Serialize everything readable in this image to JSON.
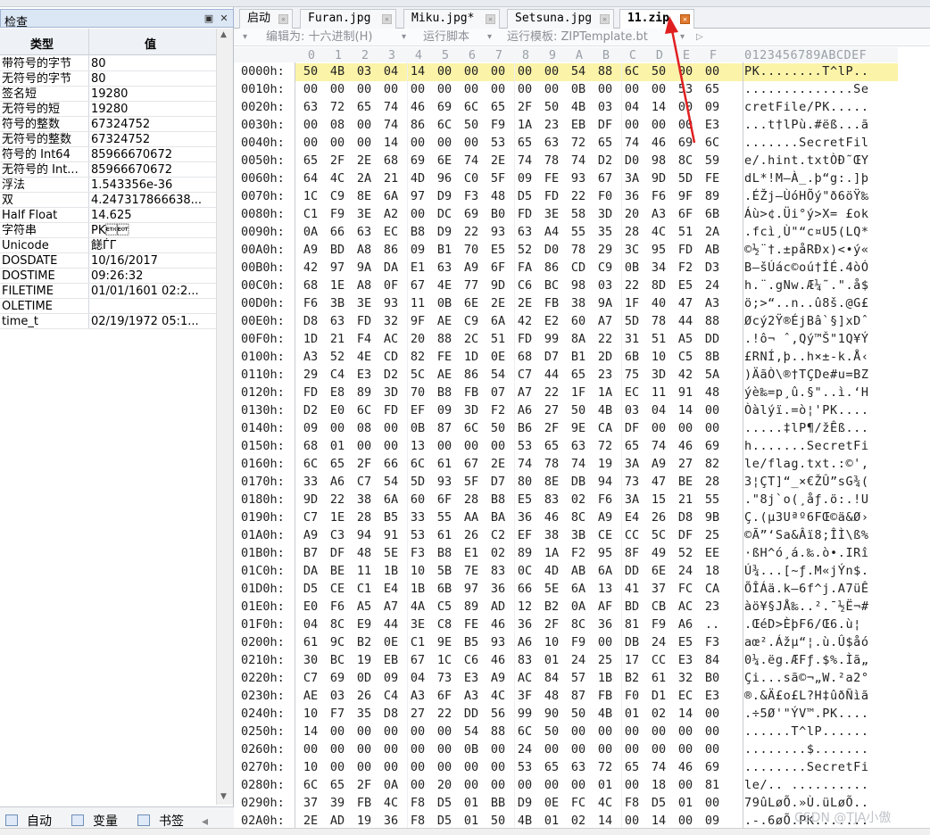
{
  "inspector": {
    "title": "检查",
    "col_type": "类型",
    "col_value": "值",
    "rows": [
      {
        "k": "带符号的字节",
        "v": "80"
      },
      {
        "k": "无符号的字节",
        "v": "80"
      },
      {
        "k": "签名短",
        "v": "19280"
      },
      {
        "k": "无符号的短",
        "v": "19280"
      },
      {
        "k": "符号的整数",
        "v": "67324752"
      },
      {
        "k": "无符号的整数",
        "v": "67324752"
      },
      {
        "k": "符号的 Int64",
        "v": "85966670672"
      },
      {
        "k": "无符号的 Int...",
        "v": "85966670672"
      },
      {
        "k": "浮法",
        "v": "1.543356e-36"
      },
      {
        "k": "双",
        "v": "4.247317866638..."
      },
      {
        "k": "Half Float",
        "v": "14.625"
      },
      {
        "k": "字符串",
        "v": "PK\u0003\u0004"
      },
      {
        "k": "Unicode",
        "v": "䭐ЃΓ"
      },
      {
        "k": "DOSDATE",
        "v": "10/16/2017"
      },
      {
        "k": "DOSTIME",
        "v": "09:26:32"
      },
      {
        "k": "FILETIME",
        "v": "01/01/1601 02:2..."
      },
      {
        "k": "OLETIME",
        "v": ""
      },
      {
        "k": "time_t",
        "v": "02/19/1972 05:1..."
      }
    ]
  },
  "bottom_tabs": [
    "自动",
    "变量",
    "书签"
  ],
  "tabs": [
    {
      "label": "启动"
    },
    {
      "label": "Furan.jpg"
    },
    {
      "label": "Miku.jpg*"
    },
    {
      "label": "Setsuna.jpg"
    },
    {
      "label": "11.zip"
    }
  ],
  "toolbar": {
    "edit_as": "编辑为: 十六进制(H)",
    "run_script": "运行脚本",
    "run_template": "运行模板: ZIPTemplate.bt"
  },
  "hex": {
    "columns": [
      "0",
      "1",
      "2",
      "3",
      "4",
      "5",
      "6",
      "7",
      "8",
      "9",
      "A",
      "B",
      "C",
      "D",
      "E",
      "F"
    ],
    "ascii_header": "0123456789ABCDEF",
    "rows": [
      {
        "o": "0000h:",
        "b": "50 4B 03 04 14 00 00 00 00 00 54 88 6C 50 00 00",
        "a": "PK........T^lP.."
      },
      {
        "o": "0010h:",
        "b": "00 00 00 00 00 00 00 00 00 00 0B 00 00 00 53 65",
        "a": "..............Se"
      },
      {
        "o": "0020h:",
        "b": "63 72 65 74 46 69 6C 65 2F 50 4B 03 04 14 00 09",
        "a": "cretFile/PK....."
      },
      {
        "o": "0030h:",
        "b": "00 08 00 74 86 6C 50 F9 1A 23 EB DF 00 00 00 E3",
        "a": "...t†lPù.#ëß...ã"
      },
      {
        "o": "0040h:",
        "b": "00 00 00 14 00 00 00 53 65 63 72 65 74 46 69 6C",
        "a": ".......SecretFil"
      },
      {
        "o": "0050h:",
        "b": "65 2F 2E 68 69 6E 74 2E 74 78 74 D2 D0 98 8C 59",
        "a": "e/.hint.txtÒÐ˜ŒY"
      },
      {
        "o": "0060h:",
        "b": "64 4C 2A 21 4D 96 C0 5F 09 FE 93 67 3A 9D 5D FE",
        "a": "dL*!M–À_.þ“g:.]þ"
      },
      {
        "o": "0070h:",
        "b": "1C C9 8E 6A 97 D9 F3 48 D5 FD 22 F0 36 F6 9F 89",
        "a": ".ÉŽj—ÙóHÕý\"ð6öŸ‰"
      },
      {
        "o": "0080h:",
        "b": "C1 F9 3E A2 00 DC 69 B0 FD 3E 58 3D 20 A3 6F 6B",
        "a": "Áù>¢.Üi°ý>X= £ok"
      },
      {
        "o": "0090h:",
        "b": "0A 66 63 EC B8 D9 22 93 63 A4 55 35 28 4C 51 2A",
        "a": ".fcì¸Ù\"“c¤U5(LQ*"
      },
      {
        "o": "00A0h:",
        "b": "A9 BD A8 86 09 B1 70 E5 52 D0 78 29 3C 95 FD AB",
        "a": "©½¨†.±påRÐx)<•ý«"
      },
      {
        "o": "00B0h:",
        "b": "42 97 9A DA E1 63 A9 6F FA 86 CD C9 0B 34 F2 D3",
        "a": "B—šÚác©oú†ÍÉ.4òÓ"
      },
      {
        "o": "00C0h:",
        "b": "68 1E A8 0F 67 4E 77 9D C6 BC 98 03 22 8D E5 24",
        "a": "h.¨.gNw.Æ¼˜.\".å$"
      },
      {
        "o": "00D0h:",
        "b": "F6 3B 3E 93 11 0B 6E 2E 2E FB 38 9A 1F 40 47 A3",
        "a": "ö;>“..n..û8š.@G£"
      },
      {
        "o": "00E0h:",
        "b": "D8 63 FD 32 9F AE C9 6A 42 E2 60 A7 5D 78 44 88",
        "a": "Øcý2Ÿ®ÉjBâ`§]xDˆ"
      },
      {
        "o": "00F0h:",
        "b": "1D 21 F4 AC 20 88 2C 51 FD 99 8A 22 31 51 A5 DD",
        "a": ".!ô¬ ˆ,Qý™Š\"1Q¥Ý"
      },
      {
        "o": "0100h:",
        "b": "A3 52 4E CD 82 FE 1D 0E 68 D7 B1 2D 6B 10 C5 8B",
        "a": "£RNÍ‚þ..h×±-k.Å‹"
      },
      {
        "o": "0110h:",
        "b": "29 C4 E3 D2 5C AE 86 54 C7 44 65 23 75 3D 42 5A",
        "a": ")ÄãÒ\\®†TÇDe#u=BZ"
      },
      {
        "o": "0120h:",
        "b": "FD E8 89 3D 70 B8 FB 07 A7 22 1F 1A EC 11 91 48",
        "a": "ýè‰=p¸û.§\"..ì.‘H"
      },
      {
        "o": "0130h:",
        "b": "D2 E0 6C FD EF 09 3D F2 A6 27 50 4B 03 04 14 00",
        "a": "Òàlýï.=ò¦'PK...."
      },
      {
        "o": "0140h:",
        "b": "09 00 08 00 0B 87 6C 50 B6 2F 9E CA DF 00 00 00",
        "a": ".....‡lP¶/žÊß..."
      },
      {
        "o": "0150h:",
        "b": "68 01 00 00 13 00 00 00 53 65 63 72 65 74 46 69",
        "a": "h.......SecretFi"
      },
      {
        "o": "0160h:",
        "b": "6C 65 2F 66 6C 61 67 2E 74 78 74 19 3A A9 27 82",
        "a": "le/flag.txt.:©'‚"
      },
      {
        "o": "0170h:",
        "b": "33 A6 C7 54 5D 93 5F D7 80 8E DB 94 73 47 BE 28",
        "a": "3¦ÇT]“_×€ŽÛ”sG¾("
      },
      {
        "o": "0180h:",
        "b": "9D 22 38 6A 60 6F 28 B8 E5 83 02 F6 3A 15 21 55",
        "a": ".\"8j`o(¸åƒ.ö:.!U"
      },
      {
        "o": "0190h:",
        "b": "C7 1E 28 B5 33 55 AA BA 36 46 8C A9 E4 26 D8 9B",
        "a": "Ç.(µ3Uªº6FŒ©ä&Ø›"
      },
      {
        "o": "01A0h:",
        "b": "A9 C3 94 91 53 61 26 C2 EF 38 3B CE CC 5C DF 25",
        "a": "©Ã”‘Sa&Âï8;ÎÌ\\ß%"
      },
      {
        "o": "01B0h:",
        "b": "B7 DF 48 5E F3 B8 E1 02 89 1A F2 95 8F 49 52 EE",
        "a": "·ßH^ó¸á.‰.ò•.IRî"
      },
      {
        "o": "01C0h:",
        "b": "DA BE 11 1B 10 5B 7E 83 0C 4D AB 6A DD 6E 24 18",
        "a": "Ú¾...[~ƒ.M«jÝn$."
      },
      {
        "o": "01D0h:",
        "b": "D5 CE C1 E4 1B 6B 97 36 66 5E 6A 13 41 37 FC CA",
        "a": "ÕÎÁä.k—6f^j.A7üÊ"
      },
      {
        "o": "01E0h:",
        "b": "E0 F6 A5 A7 4A C5 89 AD 12 B2 0A AF BD CB AC 23",
        "a": "àö¥§JÅ‰..².¯½Ë¬#"
      },
      {
        "o": "01F0h:",
        "b": "04 8C E9 44 3E C8 FE 46 36 2F 8C 36 81 F9 A6 ..",
        "a": ".ŒéD>ÈþF6/Œ6.ù¦"
      },
      {
        "o": "0200h:",
        "b": "61 9C B2 0E C1 9E B5 93 A6 10 F9 00 DB 24 E5 F3",
        "a": "aœ².Ážµ“¦.ù.Û$åó"
      },
      {
        "o": "0210h:",
        "b": "30 BC 19 EB 67 1C C6 46 83 01 24 25 17 CC E3 84",
        "a": "0¼.ëg.ÆFƒ.$%.Ìã„"
      },
      {
        "o": "0220h:",
        "b": "C7 69 0D 09 04 73 E3 A9 AC 84 57 1B B2 61 32 B0",
        "a": "Çi...sã©¬„W.²a2°"
      },
      {
        "o": "0230h:",
        "b": "AE 03 26 C4 A3 6F A3 4C 3F 48 87 FB F0 D1 EC E3",
        "a": "®.&Ä£o£L?H‡ûðÑìã"
      },
      {
        "o": "0240h:",
        "b": "10 F7 35 D8 27 22 DD 56 99 90 50 4B 01 02 14 00",
        "a": ".÷5Ø'\"ÝV™.PK...."
      },
      {
        "o": "0250h:",
        "b": "14 00 00 00 00 00 54 88 6C 50 00 00 00 00 00 00",
        "a": "......T^lP......"
      },
      {
        "o": "0260h:",
        "b": "00 00 00 00 00 00 0B 00 24 00 00 00 00 00 00 00",
        "a": "........$......."
      },
      {
        "o": "0270h:",
        "b": "10 00 00 00 00 00 00 00 53 65 63 72 65 74 46 69",
        "a": "........SecretFi"
      },
      {
        "o": "0280h:",
        "b": "6C 65 2F 0A 00 20 00 00 00 00 00 01 00 18 00 81",
        "a": "le/.. .........."
      },
      {
        "o": "0290h:",
        "b": "37 39 FB 4C F8 D5 01 BB D9 0E FC 4C F8 D5 01 00",
        "a": "79ûLøÕ.»Ù.üLøÕ.."
      },
      {
        "o": "02A0h:",
        "b": "2E AD 19 36 F8 D5 01 50 4B 01 02 14 00 14 00 09",
        "a": ".-.6øÕ.PK......."
      }
    ]
  },
  "watermark": "CSDN @TJA小傲"
}
